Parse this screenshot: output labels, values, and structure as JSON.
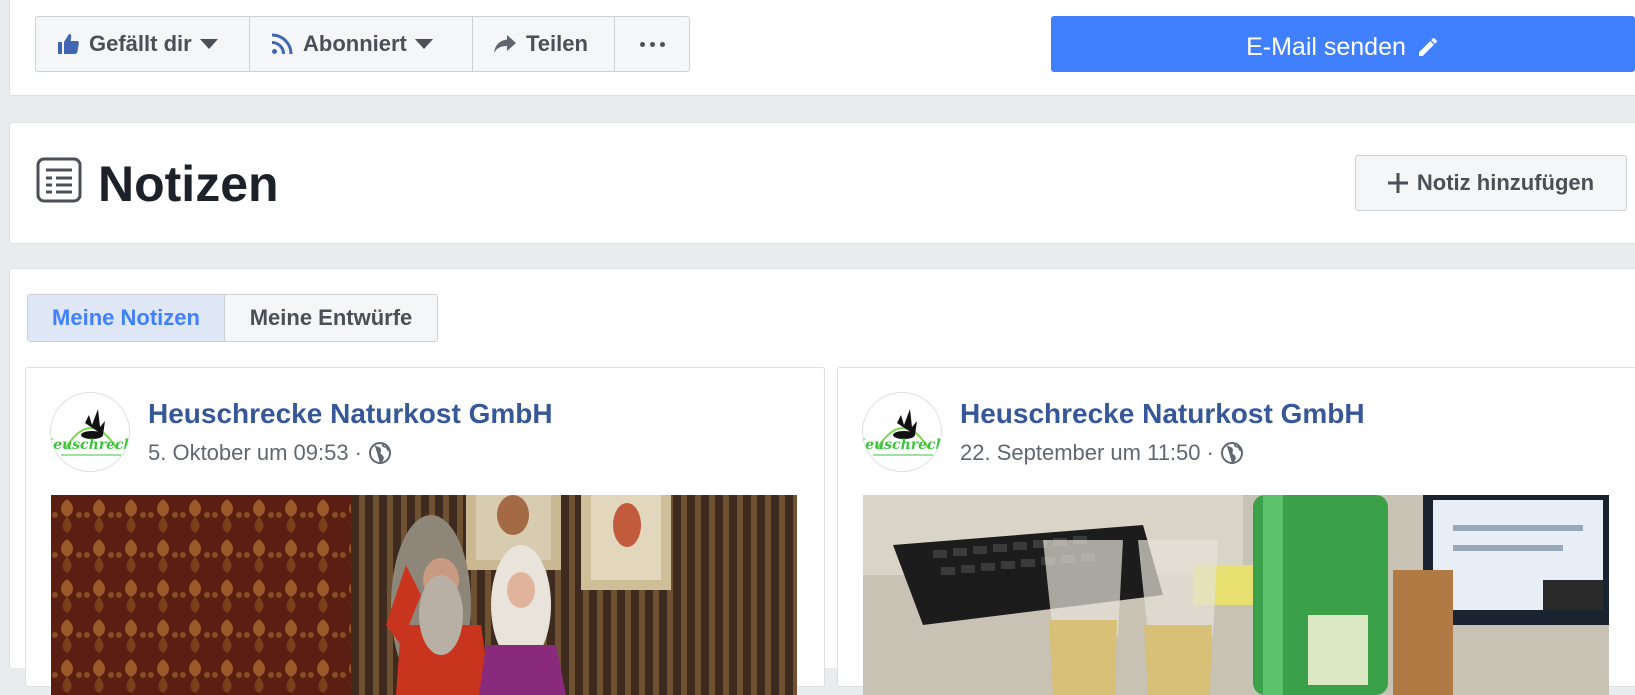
{
  "action_bar": {
    "like_label": "Gefällt dir",
    "follow_label": "Abonniert",
    "share_label": "Teilen",
    "email_label": "E-Mail senden",
    "icons": {
      "like": "thumbs-up-icon",
      "follow": "rss-feed-icon",
      "share": "share-arrow-icon",
      "more": "more-dots-icon",
      "email": "pencil-icon"
    }
  },
  "notes_header": {
    "title": "Notizen",
    "add_note_label": "Notiz hinzufügen",
    "icons": {
      "title": "notes-icon",
      "add": "plus-icon"
    }
  },
  "tabs": {
    "my_notes": "Meine Notizen",
    "my_drafts": "Meine Entwürfe",
    "active": "my_notes"
  },
  "notes": [
    {
      "author": "Heuschrecke Naturkost GmbH",
      "date": "5. Oktober um 09:53",
      "separator": "·",
      "privacy_icon": "globe-icon",
      "logo_text": "Heuschrecke",
      "image_subject": "photo of two people sitting in ornate room"
    },
    {
      "author": "Heuschrecke Naturkost GmbH",
      "date": "22. September um 11:50",
      "separator": "·",
      "privacy_icon": "globe-icon",
      "logo_text": "Heuschrecke",
      "image_subject": "photo of glasses and bottle on office desk"
    }
  ],
  "colors": {
    "page_bg": "#e9ebee",
    "primary_blue": "#4080ff",
    "link_blue": "#365899",
    "button_bg": "#f5f6f7",
    "active_tab_bg": "#dfe6f5"
  }
}
